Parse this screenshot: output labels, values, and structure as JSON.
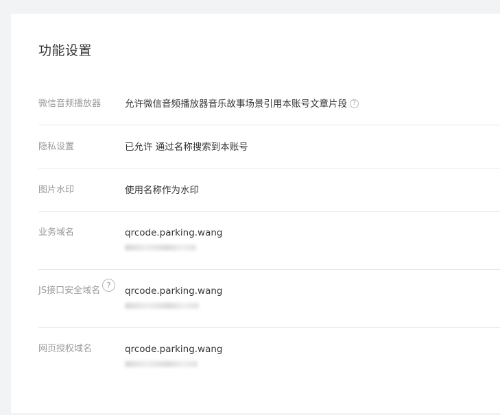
{
  "page": {
    "title": "功能设置"
  },
  "rows": {
    "player": {
      "label": "微信音频播放器",
      "value": "允许微信音频播放器音乐故事场景引用本账号文章片段",
      "help_glyph": "?"
    },
    "privacy": {
      "label": "隐私设置",
      "value": "已允许 通过名称搜索到本账号"
    },
    "watermark": {
      "label": "图片水印",
      "value": "使用名称作为水印"
    },
    "business_domain": {
      "label": "业务域名",
      "domain": "qrcode.parking.wang"
    },
    "js_domain": {
      "label": "JS接口安全域名",
      "domain": "qrcode.parking.wang",
      "help_glyph": "?"
    },
    "oauth_domain": {
      "label": "网页授权域名",
      "domain": "qrcode.parking.wang"
    }
  },
  "colors": {
    "background": "#f2f3f5",
    "card": "#ffffff",
    "label": "#9a9a9a",
    "text": "#353535",
    "divider": "#e7e7eb"
  }
}
